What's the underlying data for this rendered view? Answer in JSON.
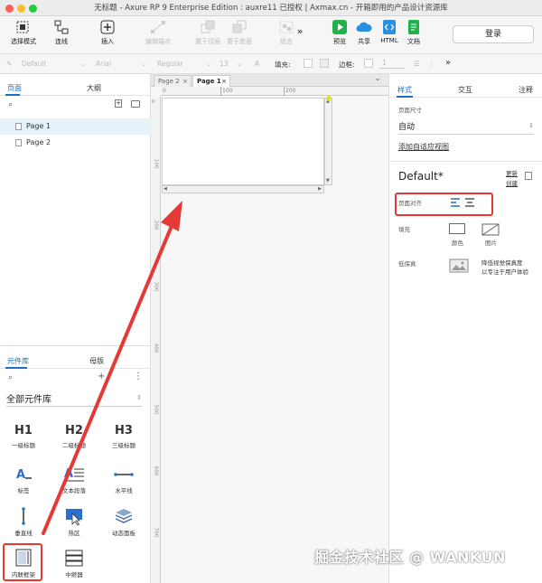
{
  "titlebar": {
    "title": "无标题 - Axure RP 9 Enterprise Edition : auxre11 已授权 | Axmax.cn - 开箱即用的产品设计资源库"
  },
  "toolbar": {
    "select_mode": "选择模式",
    "connect": "连线",
    "insert": "插入",
    "edit_point": "编辑端点",
    "top": "置于顶层",
    "bottom": "置于底层",
    "combine": "组合",
    "preview": "预览",
    "share": "共享",
    "html": "HTML",
    "doc": "文档",
    "login": "登录"
  },
  "format_bar": {
    "font_style": "Default",
    "font": "Arial",
    "weight": "Regular",
    "size": "13",
    "fill_label": "填充:",
    "border_label": "边框:",
    "border_value": "1"
  },
  "left_panel": {
    "pages_tab": "页面",
    "outline_tab": "大纲",
    "pages": [
      "Page 1",
      "Page 2"
    ],
    "lib_tab": "元件库",
    "master_tab": "母版",
    "lib_select": "全部元件库",
    "widgets": [
      {
        "big": "H1",
        "label": "一级标题"
      },
      {
        "big": "H2",
        "label": "二级标题"
      },
      {
        "big": "H3",
        "label": "三级标题"
      },
      {
        "label": "标签"
      },
      {
        "label": "文本段落"
      },
      {
        "label": "水平线"
      },
      {
        "label": "垂直线"
      },
      {
        "label": "热区"
      },
      {
        "label": "动态面板"
      },
      {
        "label": "内联框架"
      },
      {
        "label": "中继器"
      }
    ]
  },
  "canvas": {
    "tabs": [
      "Page 2",
      "Page 1"
    ],
    "hruler": [
      "0",
      "100",
      "200"
    ],
    "vruler": [
      "0",
      "100",
      "200",
      "300",
      "400",
      "500",
      "600",
      "700"
    ]
  },
  "right_panel": {
    "tabs": [
      "样式",
      "交互",
      "注释"
    ],
    "page_size_label": "页面尺寸",
    "page_size_value": "自动",
    "adaptive_link": "添加自适应视图",
    "style_name": "Default*",
    "update_label": "更新",
    "create_label": "创建",
    "align_label": "页面对齐",
    "fill_label": "填充",
    "color_label": "颜色",
    "image_label": "图片",
    "lowfi_label": "低保真",
    "lowfi_desc1": "降低视觉保真度",
    "lowfi_desc2": "以专注于用户体验"
  },
  "watermark": "掘金技术社区 @ WANKUN",
  "colors": {
    "accent": "#1b6ec2",
    "annotation": "#e53935",
    "selected_page": "#e5f3f8"
  }
}
